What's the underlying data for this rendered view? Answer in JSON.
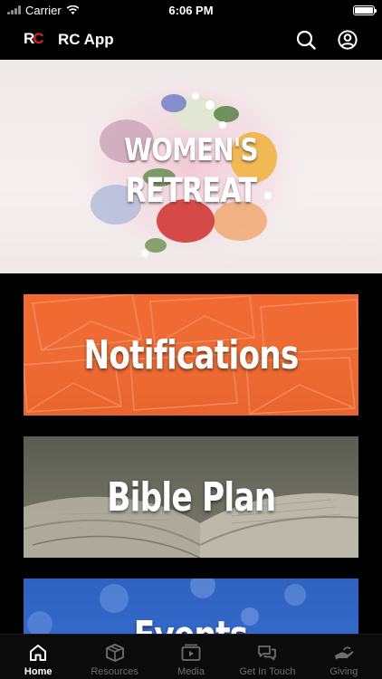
{
  "status_bar": {
    "carrier": "Carrier",
    "time": "6:06 PM"
  },
  "app_bar": {
    "logo_r": "R",
    "logo_c": "C",
    "title": "RC App"
  },
  "hero": {
    "line1": "WOMEN'S",
    "line2": "RETREAT"
  },
  "tiles": [
    {
      "label": "Notifications",
      "color": "#ee6c34"
    },
    {
      "label": "Bible Plan",
      "color": "#6b6b5e"
    },
    {
      "label": "Events",
      "color": "#3a6ed0"
    }
  ],
  "tabs": [
    {
      "label": "Home",
      "icon": "home-icon",
      "active": true
    },
    {
      "label": "Resources",
      "icon": "box-icon",
      "active": false
    },
    {
      "label": "Media",
      "icon": "play-icon",
      "active": false
    },
    {
      "label": "Get In Touch",
      "icon": "chat-icon",
      "active": false
    },
    {
      "label": "Giving",
      "icon": "hand-icon",
      "active": false
    }
  ]
}
